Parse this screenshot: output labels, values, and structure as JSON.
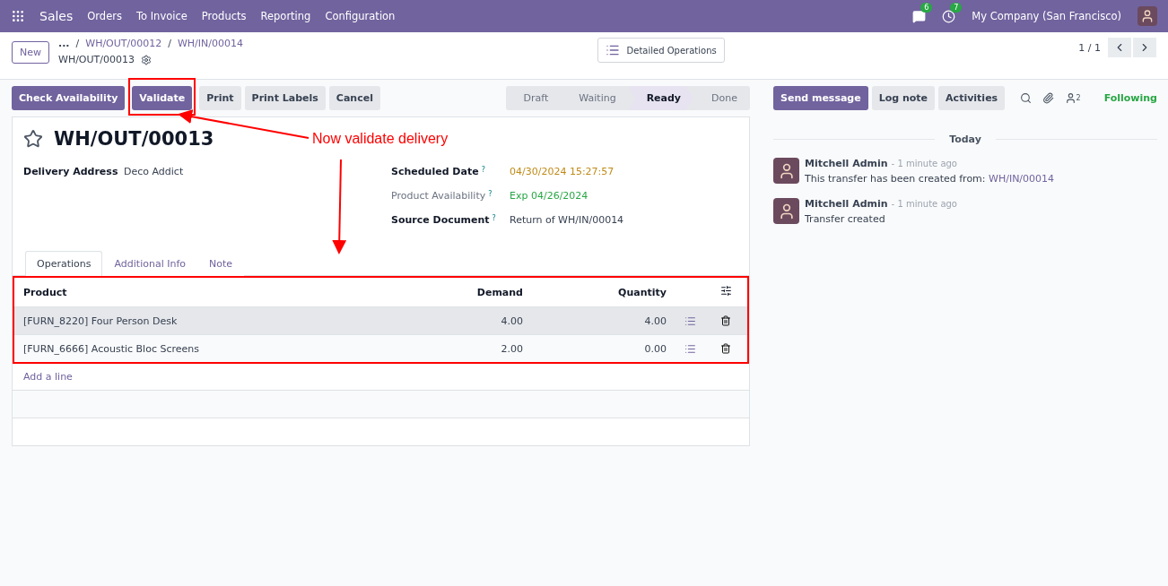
{
  "navbar": {
    "app": "Sales",
    "menu": [
      "Orders",
      "To Invoice",
      "Products",
      "Reporting",
      "Configuration"
    ],
    "chat_count": "6",
    "activity_count": "7",
    "company": "My Company (San Francisco)"
  },
  "control_panel": {
    "new_button": "New",
    "more": "...",
    "breadcrumbs": [
      {
        "separator": "/",
        "label": "WH/OUT/00012"
      },
      {
        "separator": "/",
        "label": "WH/IN/00014"
      }
    ],
    "current": "WH/OUT/00013",
    "detailed_operations": "Detailed Operations",
    "pager": "1 / 1"
  },
  "actions": [
    {
      "label": "Check Availability",
      "primary": true,
      "highlighted": false
    },
    {
      "label": "Validate",
      "primary": true,
      "highlighted": true
    },
    {
      "label": "Print",
      "primary": false,
      "highlighted": false
    },
    {
      "label": "Print Labels",
      "primary": false,
      "highlighted": false
    },
    {
      "label": "Cancel",
      "primary": false,
      "highlighted": false
    }
  ],
  "status": [
    {
      "label": "Draft",
      "selected": false
    },
    {
      "label": "Waiting",
      "selected": false
    },
    {
      "label": "Ready",
      "selected": true
    },
    {
      "label": "Done",
      "selected": false
    }
  ],
  "form": {
    "title": "WH/OUT/00013",
    "starred": false,
    "left_fields": [
      {
        "label": "Delivery Address",
        "muted": false,
        "value": "Deco Addict",
        "color": "#374151"
      }
    ],
    "right_fields": [
      {
        "label": "Scheduled Date",
        "help": "?",
        "muted": false,
        "value": "04/30/2024 15:27:57",
        "color": "#c08a17"
      },
      {
        "label": "Product Availability",
        "help": "?",
        "muted": true,
        "value": "Exp 04/26/2024",
        "color": "#28a745"
      },
      {
        "label": "Source Document",
        "help": "?",
        "muted": false,
        "value": "Return of WH/IN/00014",
        "color": "#374151"
      }
    ],
    "tabs": [
      {
        "label": "Operations",
        "selected": true
      },
      {
        "label": "Additional Info",
        "selected": false
      },
      {
        "label": "Note",
        "selected": false
      }
    ],
    "table": {
      "highlighted": true,
      "columns": [
        "Product",
        "Demand",
        "Quantity"
      ],
      "rows": [
        {
          "product": "[FURN_8220] Four Person Desk",
          "demand": "4.00",
          "quantity": "4.00",
          "selected": true
        },
        {
          "product": "[FURN_6666] Acoustic Bloc Screens",
          "demand": "2.00",
          "quantity": "0.00",
          "selected": false
        }
      ],
      "add_line": "Add a line"
    }
  },
  "chatter": {
    "buttons": [
      {
        "label": "Send message",
        "primary": true
      },
      {
        "label": "Log note",
        "primary": false
      },
      {
        "label": "Activities",
        "primary": false
      }
    ],
    "followers": "2",
    "follow": "Following",
    "date": "Today",
    "messages": [
      {
        "author": "Mitchell Admin",
        "time": "- 1 minute ago",
        "body": "This transfer has been created from:",
        "link": "WH/IN/00014"
      },
      {
        "author": "Mitchell Admin",
        "time": "- 1 minute ago",
        "body": "Transfer created"
      }
    ]
  },
  "annotation": {
    "text": "Now validate delivery"
  }
}
